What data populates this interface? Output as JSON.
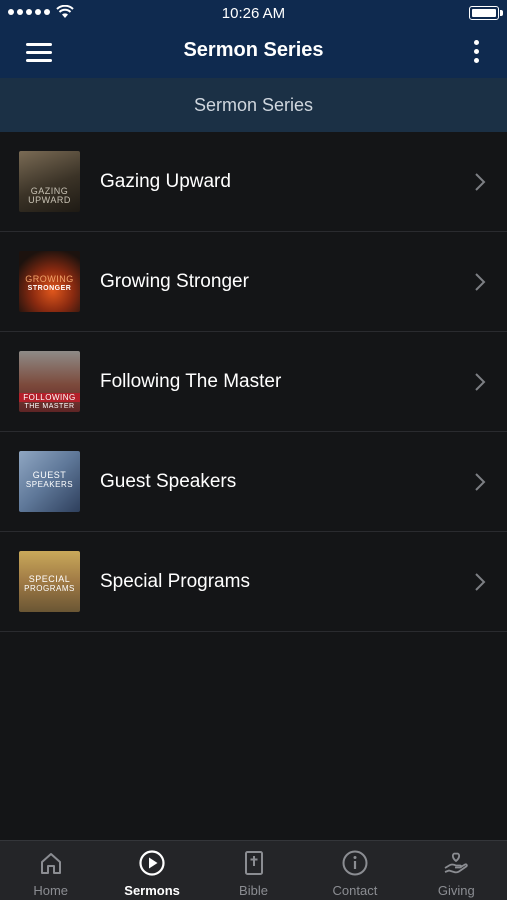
{
  "status_bar": {
    "time": "10:26 AM"
  },
  "nav": {
    "title": "Sermon Series"
  },
  "section_header": "Sermon Series",
  "series": [
    {
      "title": "Gazing Upward",
      "thumb_text": [
        "GAZING",
        "UPWARD"
      ]
    },
    {
      "title": "Growing Stronger",
      "thumb_text": [
        "GROWING",
        "STRONGER"
      ]
    },
    {
      "title": "Following The Master",
      "thumb_text": [
        "FOLLOWING",
        "THE MASTER"
      ]
    },
    {
      "title": "Guest Speakers",
      "thumb_text": [
        "GUEST",
        "SPEAKERS"
      ]
    },
    {
      "title": "Special Programs",
      "thumb_text": [
        "SPECIAL",
        "PROGRAMS"
      ]
    }
  ],
  "tabs": [
    {
      "label": "Home",
      "icon": "home-icon",
      "active": false
    },
    {
      "label": "Sermons",
      "icon": "play-circle-icon",
      "active": true
    },
    {
      "label": "Bible",
      "icon": "bible-icon",
      "active": false
    },
    {
      "label": "Contact",
      "icon": "info-icon",
      "active": false
    },
    {
      "label": "Giving",
      "icon": "giving-hand-icon",
      "active": false
    }
  ],
  "colors": {
    "nav_background": "#0f2a4f",
    "section_header_background": "#1b3045",
    "list_background": "#141517",
    "tab_bar_background": "#242528",
    "tab_inactive": "#8b8d92",
    "tab_active": "#ffffff"
  }
}
